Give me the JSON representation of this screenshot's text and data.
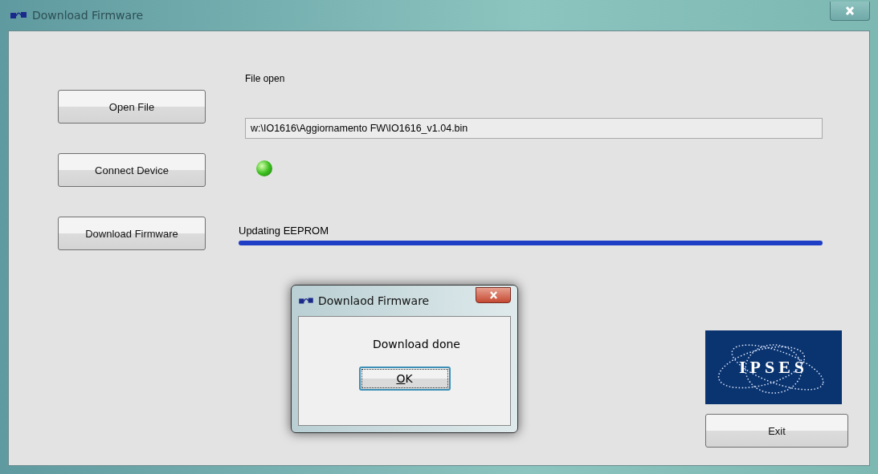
{
  "window": {
    "title": "Download Firmware"
  },
  "file_label": "File open",
  "file_path": "w:\\IO1616\\Aggiornamento FW\\IO1616_v1.04.bin",
  "buttons": [
    {
      "label": "Open File"
    },
    {
      "label": "Connect Device"
    },
    {
      "label": "Download Firmware"
    }
  ],
  "device_led": {
    "on": true
  },
  "progress": {
    "label": "Updating  EEPROM",
    "level": 1
  },
  "logo": {
    "text": "IPSES"
  },
  "exit_button": "Exit",
  "dialog": {
    "title": "Downlaod Firmware",
    "message": "Download done",
    "button": "OK"
  }
}
